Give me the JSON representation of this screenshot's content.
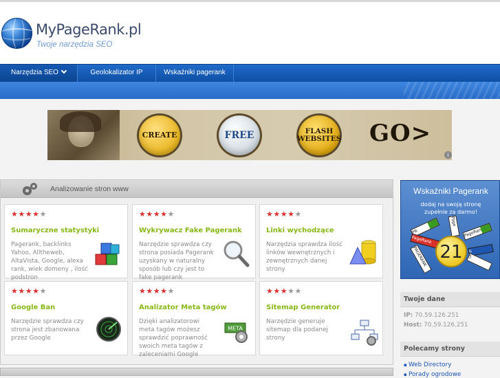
{
  "header": {
    "logo_title": "MyPageRank.pl",
    "tagline": "Twoje narzędzia SEO"
  },
  "nav": {
    "items": [
      {
        "label": "Narzędzia SEO",
        "dropdown": true
      },
      {
        "label": "Geolokalizator IP"
      },
      {
        "label": "Wskaźniki pagerank"
      }
    ]
  },
  "banner": {
    "badges": [
      "CREATE",
      "FREE",
      "FLASH\nWEBSITES"
    ],
    "go_label": "GO>",
    "info_icon": "i"
  },
  "panel": {
    "title": "Analizowanie stron www",
    "cards": [
      {
        "rating": 4,
        "max": 5,
        "title": "Sumaryczne statystyki",
        "desc": "Pagerank, backlinks Yahoo, Alltheweb, AltaVista, Google, alexa rank, wiek domeny , ilość podstron",
        "icon": "cubes-icon"
      },
      {
        "rating": 4,
        "max": 5,
        "title": "Wykrywacz Fake Pagerank",
        "desc": "Narzędzie sprawdza czy strona posiada Pagerank uzyskany w naturalny sposób lub czy jest to fake pagerank",
        "icon": "magnifier-icon"
      },
      {
        "rating": 4,
        "max": 5,
        "title": "Linki wychodzące",
        "desc": "Narzędzia sprawdza ilość linków wewnętrznych i zewnętrznych danej strony",
        "icon": "shapes-icon"
      },
      {
        "rating": 4,
        "max": 5,
        "title": "Google Ban",
        "desc": "Narzędzie sprawdza czy strona jest zbanowana przez Google",
        "icon": "radar-icon"
      },
      {
        "rating": 4,
        "max": 5,
        "title": "Analizator Meta tagów",
        "desc": "Dzięki analizatorowi meta tagów możesz sprawdzić poprawność swoich meta tagów z zaleceniami Google",
        "icon": "meta-gear-icon",
        "icon_text": "META"
      },
      {
        "rating": 3,
        "max": 5,
        "title": "Sitemap Generator",
        "desc": "Narzędzie generuje sitemap dla podanej strony",
        "icon": "sitemap-icon"
      }
    ]
  },
  "sidebar": {
    "promo": {
      "title": "Wskaźniki Pagerank",
      "subtitle": "dodaj na swoją stronę\nzupełnie za darmo!",
      "number": "21",
      "card_labels": [
        "PR",
        "Page",
        "PageRank",
        "PageRank",
        "PAGERANK",
        "6",
        "5"
      ]
    },
    "twoje_dane": {
      "heading": "Twoje dane",
      "ip_label": "IP:",
      "ip_value": "70.59.126.251",
      "host_label": "Host:",
      "host_value": "70.59.126.251"
    },
    "polecamy": {
      "heading": "Polecamy strony",
      "links": [
        "Web Directory",
        "Porady ogrodowe"
      ]
    }
  },
  "colors": {
    "nav_blue": "#1f6bc9",
    "card_title_green": "#88b816",
    "star_red": "#d9322f",
    "link_blue": "#1a55b8"
  }
}
